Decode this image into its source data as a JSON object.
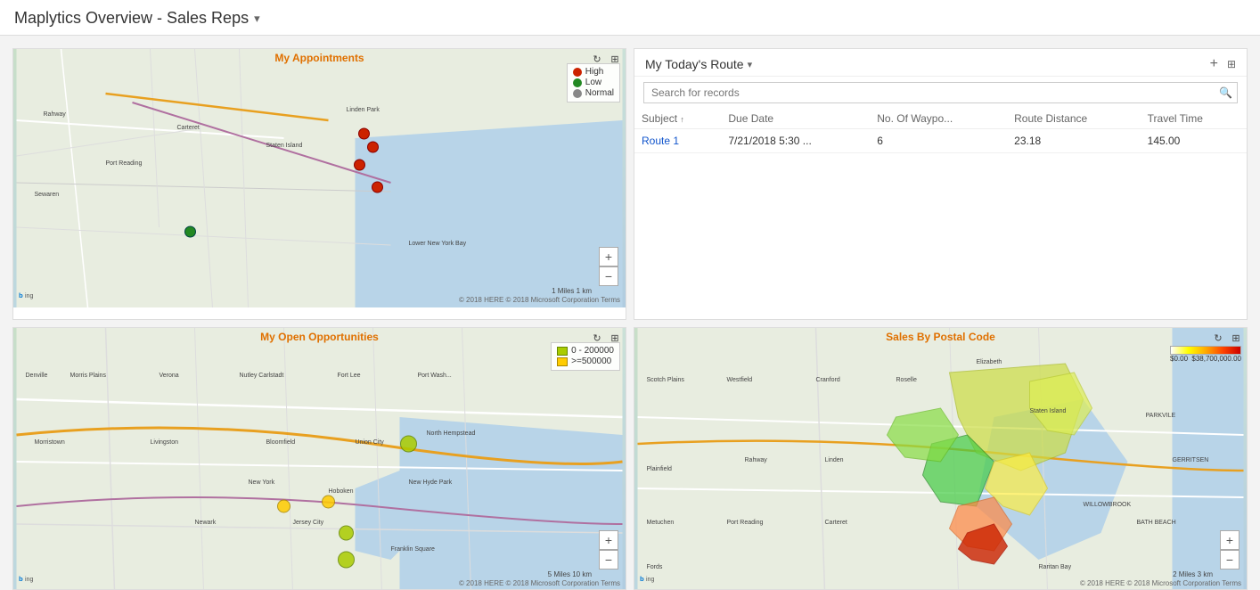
{
  "header": {
    "title": "Maplytics Overview - Sales Reps",
    "dropdown_icon": "▾"
  },
  "panels": {
    "appointments": {
      "title": "My Appointments",
      "legend": [
        {
          "label": "High",
          "color": "#cc2200"
        },
        {
          "label": "Low",
          "color": "#228822"
        },
        {
          "label": "Normal",
          "color": "#888888"
        }
      ],
      "copyright": "© 2018 HERE © 2018 Microsoft Corporation  Terms",
      "scale": "1 Miles  1 km"
    },
    "route": {
      "title": "My Today's Route",
      "search_placeholder": "Search for records",
      "columns": [
        {
          "label": "Subject",
          "sort": "↑"
        },
        {
          "label": "Due Date"
        },
        {
          "label": "No. Of Waypo..."
        },
        {
          "label": "Route Distance"
        },
        {
          "label": "Travel Time"
        }
      ],
      "rows": [
        {
          "subject": "Route 1",
          "due_date": "7/21/2018 5:30 ...",
          "waypoints": "6",
          "distance": "23.18",
          "travel_time": "145.00"
        }
      ],
      "add_btn": "+",
      "grid_btn": "⊞"
    },
    "opportunities": {
      "title": "My Open Opportunities",
      "legend": [
        {
          "label": "0 - 200000",
          "color": "#aacc00"
        },
        {
          "label": ">=500000",
          "color": "#ffcc00"
        }
      ],
      "copyright": "© 2018 HERE © 2018 Microsoft Corporation  Terms",
      "scale": "5 Miles  10 km"
    },
    "postal": {
      "title": "Sales By Postal Code",
      "gradient_min": "$0.00",
      "gradient_max": "$38,700,000.00",
      "copyright": "© 2018 HERE © 2018 Microsoft Corporation  Terms",
      "scale": "2 Miles  3 km"
    }
  }
}
